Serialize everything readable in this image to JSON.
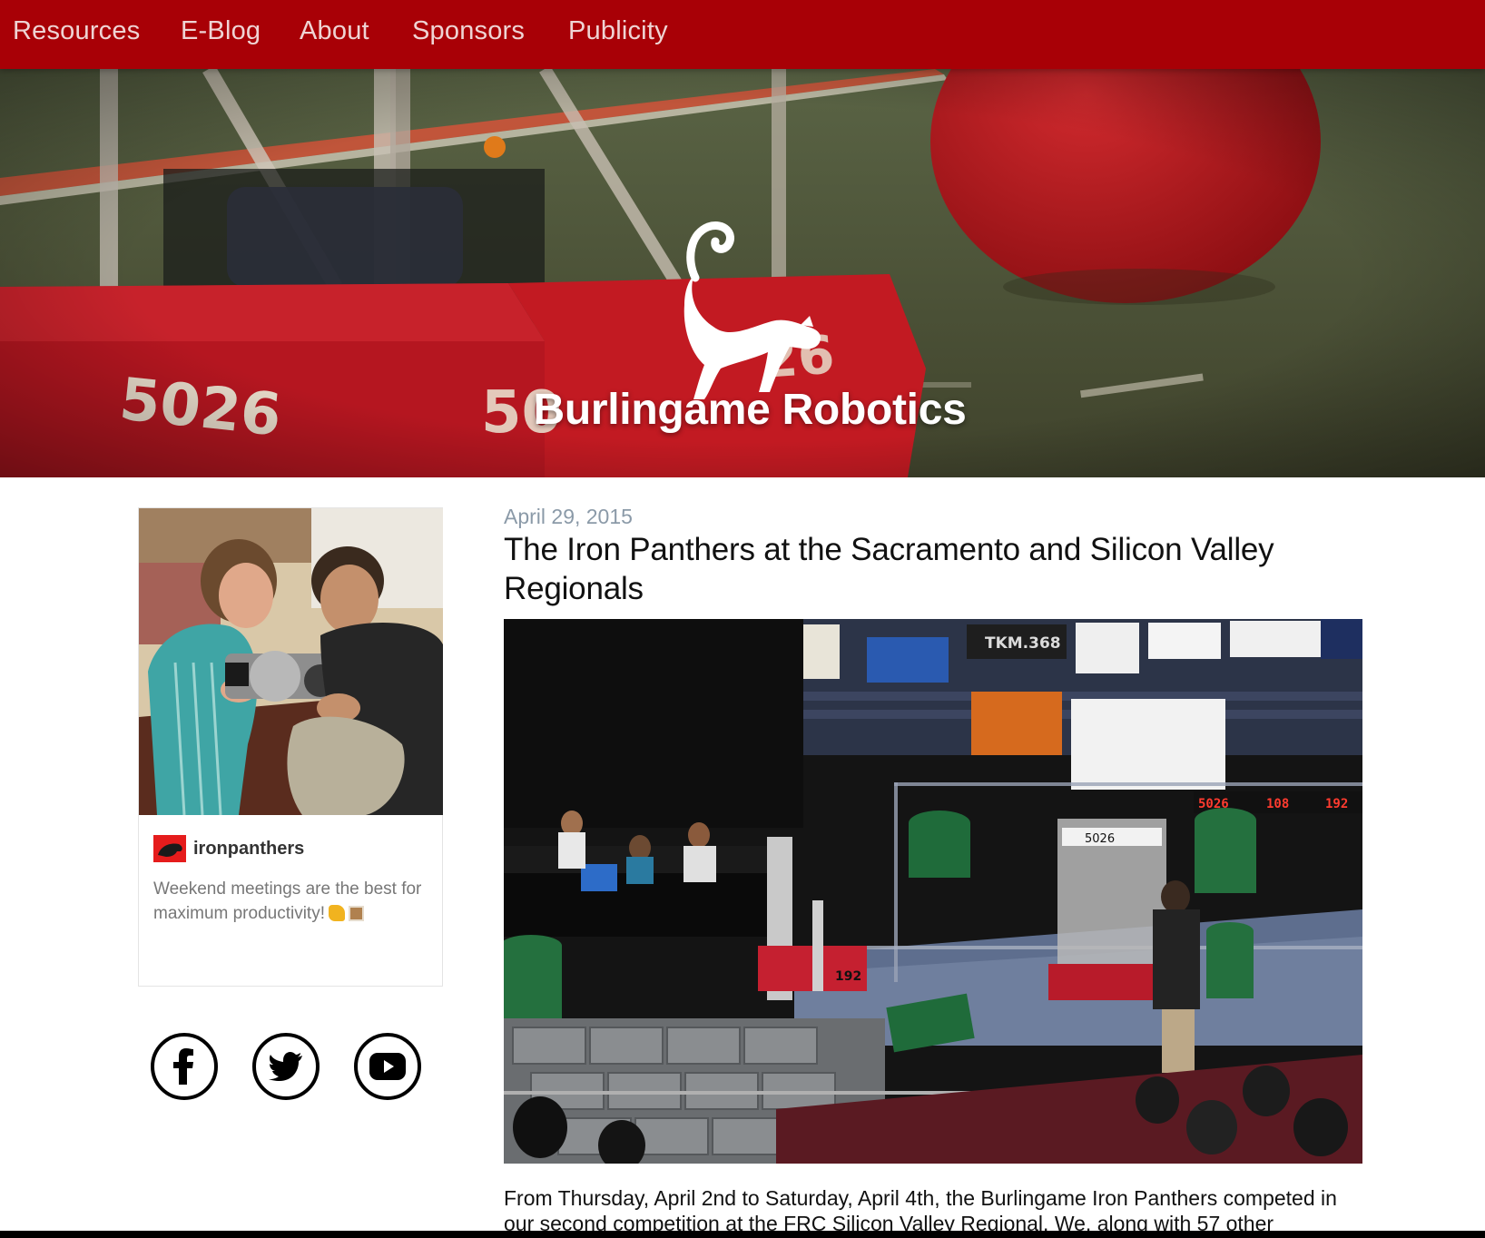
{
  "nav": {
    "items": [
      {
        "label": "Resources"
      },
      {
        "label": "E-Blog"
      },
      {
        "label": "About"
      },
      {
        "label": "Sponsors"
      },
      {
        "label": "Publicity"
      }
    ]
  },
  "hero": {
    "title": "Burlingame Robotics",
    "robot_number": "5026",
    "robot_number_partial": "50",
    "robot_number_side": "26"
  },
  "sidebar": {
    "instagram": {
      "username": "ironpanthers",
      "caption": "Weekend meetings are the best for maximum productivity!"
    },
    "social": [
      {
        "name": "facebook"
      },
      {
        "name": "twitter"
      },
      {
        "name": "youtube"
      }
    ]
  },
  "post": {
    "date": "April 29, 2015",
    "title": "The Iron Panthers at the Sacramento and Silicon Valley Regionals",
    "body": "From Thursday, April 2nd to Saturday, April 4th, the Burlingame Iron Panthers competed in our second competition at the FRC Silicon Valley Regional. We, along with 57 other",
    "image_text": {
      "sign_tkm": "TKM.368",
      "score_left": "5026",
      "score_mid": "108",
      "score_right": "192",
      "robot_label": "5026",
      "bumper_label": "192"
    }
  },
  "colors": {
    "nav_bg": "#a80006",
    "nav_text": "#efd4d4",
    "date_text": "#8b9aa8"
  }
}
